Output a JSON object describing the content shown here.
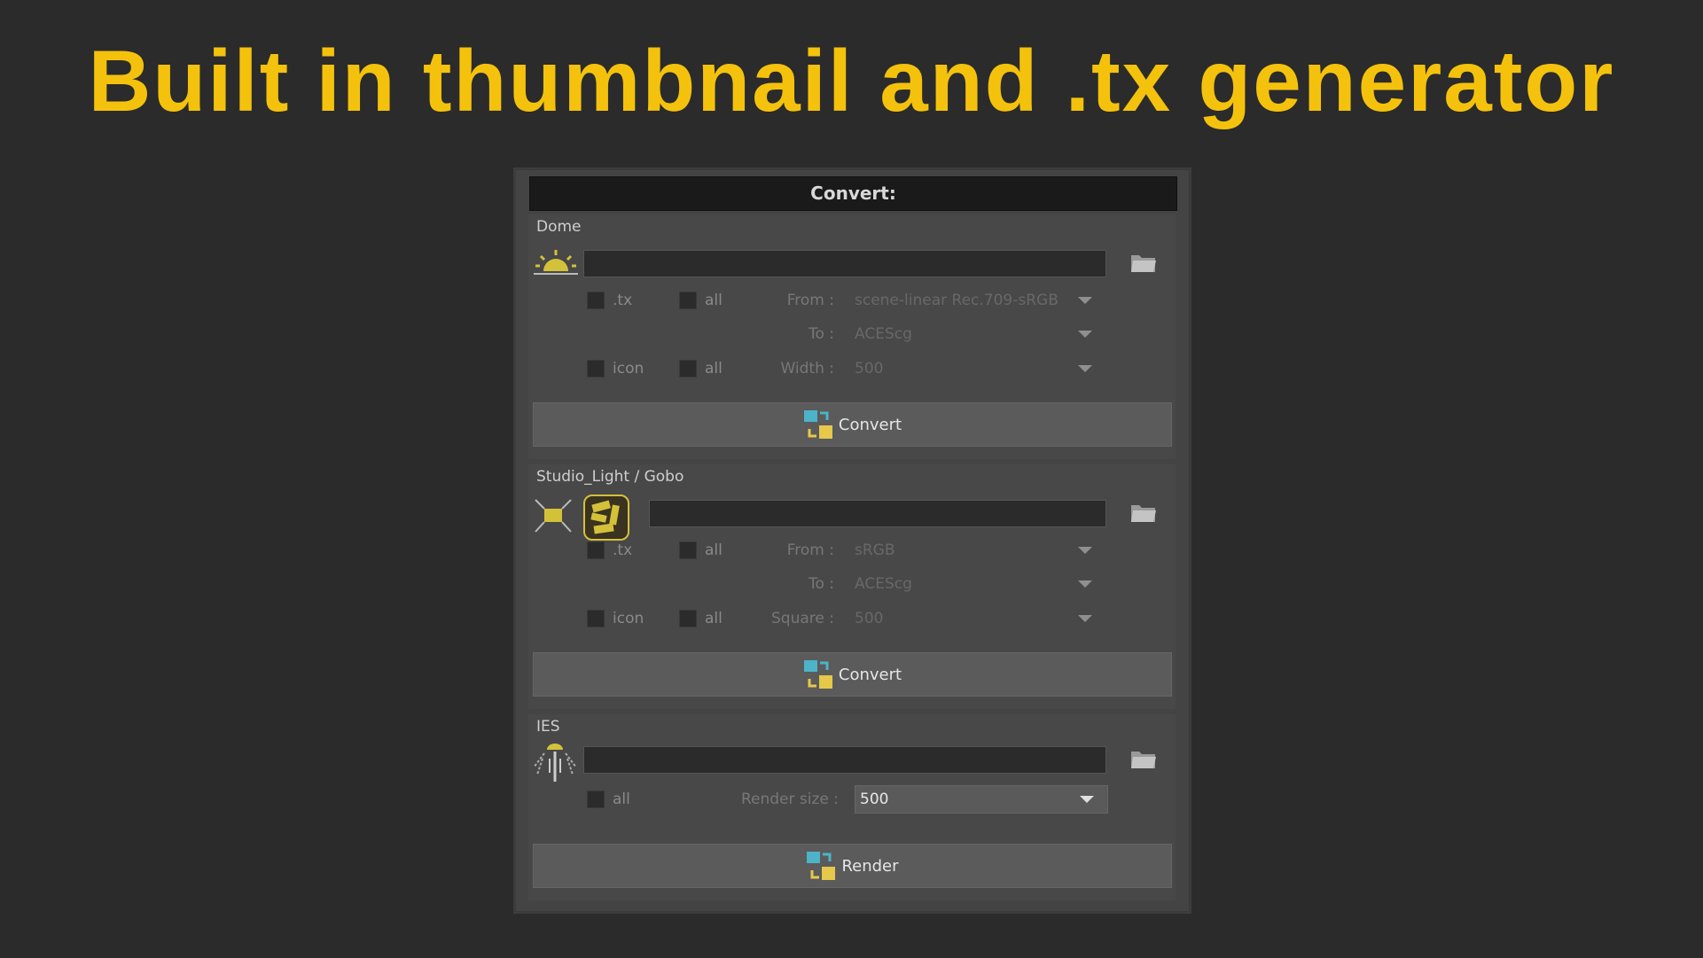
{
  "headline": "Built in thumbnail and .tx generator",
  "panel": {
    "title": "Convert:"
  },
  "dome": {
    "label": "Dome",
    "path_value": "",
    "tx_label": ".tx",
    "icon_label": "icon",
    "all_label": "all",
    "from_label": "From :",
    "from_value": "scene-linear Rec.709-sRGB",
    "to_label": "To :",
    "to_value": "ACEScg",
    "width_label": "Width :",
    "width_value": "500",
    "button_label": "Convert"
  },
  "studio": {
    "label": "Studio_Light / Gobo",
    "path_value": "",
    "tx_label": ".tx",
    "icon_label": "icon",
    "all_label": "all",
    "from_label": "From :",
    "from_value": "sRGB",
    "to_label": "To :",
    "to_value": "ACEScg",
    "square_label": "Square :",
    "square_value": "500",
    "button_label": "Convert"
  },
  "ies": {
    "label": "IES",
    "path_value": "",
    "all_label": "all",
    "render_size_label": "Render size :",
    "render_size_value": "500",
    "button_label": "Render"
  },
  "colors": {
    "headline": "#f4c20d",
    "icon_yellow": "#d4c13a",
    "panel_bg": "#444444"
  }
}
